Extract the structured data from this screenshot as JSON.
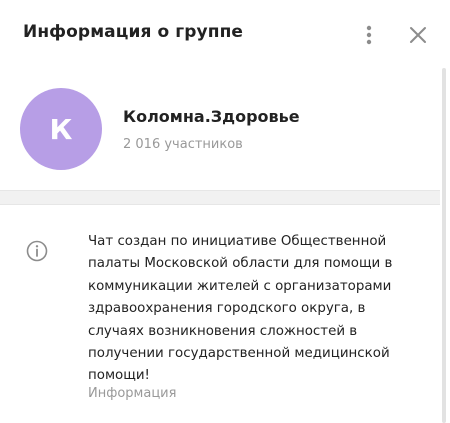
{
  "header": {
    "title": "Информация о группе",
    "menu_icon": "more-vertical-icon",
    "close_icon": "close-icon"
  },
  "profile": {
    "avatar_letter": "К",
    "avatar_color": "#b79ee6",
    "name": "Коломна.Здоровье",
    "members": "2 016 участников"
  },
  "info": {
    "icon": "info-icon",
    "description": "Чат создан по инициативе Общественной\nпалаты Московской области для помощи в\nкоммуникации жителей с организаторами\nздравоохранения городского округа, в\nслучаях возникновения сложностей в\nполучении государственной медицинской\nпомощи!",
    "caption": "Информация"
  }
}
